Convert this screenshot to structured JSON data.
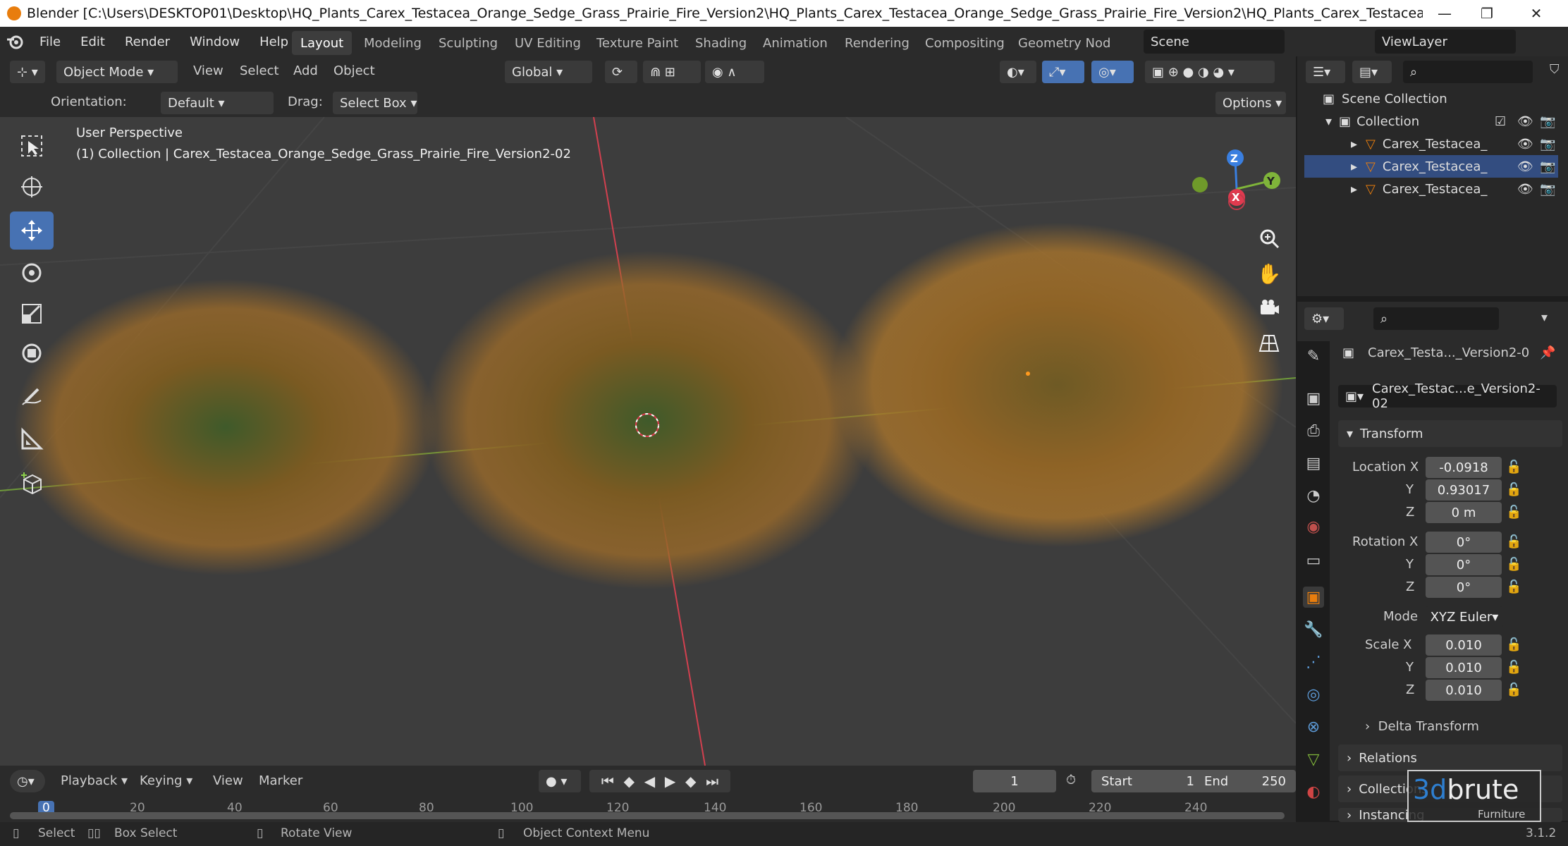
{
  "window": {
    "title": "Blender [C:\\Users\\DESKTOP01\\Desktop\\HQ_Plants_Carex_Testacea_Orange_Sedge_Grass_Prairie_Fire_Version2\\HQ_Plants_Carex_Testacea_Orange_Sedge_Grass_Prairie_Fire_Version2\\HQ_Plants_Carex_Testacea_Orange_Sedge_Gra...",
    "minimize": "—",
    "maximize": "❐",
    "close": "✕"
  },
  "menu": [
    "File",
    "Edit",
    "Render",
    "Window",
    "Help"
  ],
  "workspaces": [
    "Layout",
    "Modeling",
    "Sculpting",
    "UV Editing",
    "Texture Paint",
    "Shading",
    "Animation",
    "Rendering",
    "Compositing",
    "Geometry Nod"
  ],
  "scene": {
    "name": "Scene",
    "view_layer": "ViewLayer"
  },
  "header": {
    "mode": "Object Mode",
    "view": "View",
    "select": "Select",
    "add": "Add",
    "object": "Object",
    "transform_orientation": "Global"
  },
  "tool_settings": {
    "orientation_label": "Orientation:",
    "orientation_value": "Default",
    "drag_label": "Drag:",
    "drag_value": "Select Box",
    "options": "Options"
  },
  "viewport": {
    "perspective": "User Perspective",
    "collection_info": "(1) Collection | Carex_Testacea_Orange_Sedge_Grass_Prairie_Fire_Version2-02",
    "gizmo": {
      "z": "Z",
      "y": "Y",
      "x": "X"
    }
  },
  "outliner": {
    "scene_collection": "Scene Collection",
    "collection": "Collection",
    "objects": [
      "Carex_Testacea_",
      "Carex_Testacea_",
      "Carex_Testacea_"
    ]
  },
  "properties": {
    "object_name": "Carex_Testa..._Version2-0",
    "data_name": "Carex_Testac...e_Version2-02",
    "transform_label": "Transform",
    "location_label": "Location X",
    "location": [
      "-0.0918",
      "0.93017",
      "0 m"
    ],
    "rotation_label": "Rotation X",
    "rotation": [
      "0°",
      "0°",
      "0°"
    ],
    "mode_label": "Mode",
    "mode_value": "XYZ Euler",
    "scale_label": "Scale X",
    "scale": [
      "0.010",
      "0.010",
      "0.010"
    ],
    "axis_y": "Y",
    "axis_z": "Z",
    "delta_transform": "Delta Transform",
    "relations": "Relations",
    "collections": "Collections",
    "instancing": "Instancing"
  },
  "timeline": {
    "playback": "Playback",
    "keying": "Keying",
    "view": "View",
    "marker": "Marker",
    "current_frame": "1",
    "start_label": "Start",
    "start": "1",
    "end_label": "End",
    "end": "250",
    "ticks": [
      "0",
      "20",
      "40",
      "60",
      "80",
      "100",
      "120",
      "140",
      "160",
      "180",
      "200",
      "220",
      "240"
    ]
  },
  "status": {
    "select": "Select",
    "box_select": "Box Select",
    "rotate_view": "Rotate View",
    "context_menu": "Object Context Menu",
    "version": "3.1.2"
  },
  "watermark": {
    "brand_prefix": "3d",
    "brand": "brute",
    "sub": "Furniture"
  },
  "colors": {
    "accent": "#4772b3",
    "orange": "#e87d0d",
    "x_axis": "#e03a4f",
    "y_axis": "#7fb43a",
    "z_axis": "#3a7fe0"
  }
}
